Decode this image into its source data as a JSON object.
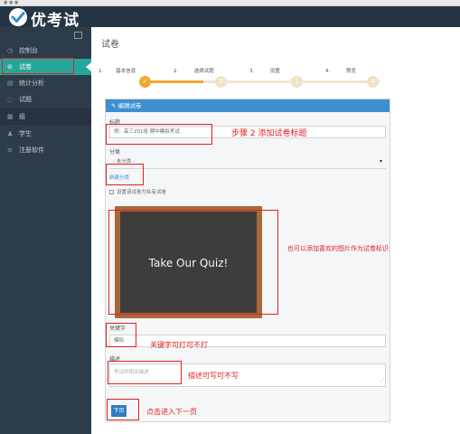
{
  "topbar": {
    "app_name": "优考试"
  },
  "sidebar": {
    "items": [
      {
        "label": "控制台",
        "icon": "dashboard-icon"
      },
      {
        "label": "试卷",
        "icon": "exam-icon",
        "active": true
      },
      {
        "label": "统计分析",
        "icon": "stats-icon"
      },
      {
        "label": "试题",
        "icon": "question-icon"
      },
      {
        "label": "组",
        "icon": "group-icon"
      },
      {
        "label": "学生",
        "icon": "student-icon"
      },
      {
        "label": "注册软件",
        "icon": "register-icon"
      }
    ]
  },
  "main": {
    "page_title": "试卷",
    "steps": [
      {
        "number": "1.",
        "label": "基本信息",
        "dot": "",
        "done": true
      },
      {
        "number": "2.",
        "label": "选择试题",
        "dot": "2",
        "done": false
      },
      {
        "number": "3.",
        "label": "设置",
        "dot": "3",
        "done": false
      },
      {
        "number": "4.",
        "label": "预览",
        "dot": "4",
        "done": false
      }
    ],
    "progress_fraction": 0.25
  },
  "form": {
    "panel_title": "编辑试卷",
    "title_label": "标题",
    "title_value": "例：高三201班 期中模拟考试",
    "category_label": "分类",
    "category_value": "- 未分类 -",
    "new_category_link": "新建分类",
    "public_checkbox_label": "设置该试卷为私有试卷",
    "cover_text": "Take Our Quiz!",
    "keyword_label": "关键字",
    "keyword_value": "模拟",
    "description_label": "描述",
    "description_placeholder": "考试的相关描述",
    "next_button": "下页"
  },
  "annotations": {
    "step2_title": "步骤 2 添加试卷标题",
    "image_note": "也可以添加喜欢的图片作为试卷标识",
    "keyword_note": "关键字可打可不打",
    "description_note": "描述可写可不写",
    "next_note": "点击进入下一页"
  },
  "colors": {
    "accent": "#26a69a",
    "panel_header": "#3d8fd0",
    "step_active": "#f0a830",
    "annotation": "#e02020"
  }
}
